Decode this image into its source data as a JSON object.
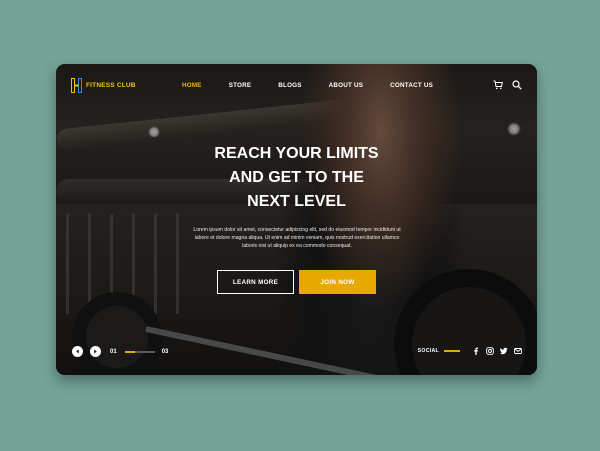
{
  "brand": {
    "name": "FITNESS CLUB",
    "accent": "#f2c400"
  },
  "nav": {
    "items": [
      {
        "label": "HOME",
        "active": true
      },
      {
        "label": "STORE",
        "active": false
      },
      {
        "label": "BLOGS",
        "active": false
      },
      {
        "label": "ABOUT US",
        "active": false
      },
      {
        "label": "CONTACT US",
        "active": false
      }
    ],
    "icons": [
      "cart-icon",
      "search-icon"
    ]
  },
  "hero": {
    "headline": [
      "REACH YOUR LIMITS",
      "AND GET TO THE",
      "NEXT LEVEL"
    ],
    "paragraph": "Lorem ipsum dolor sit amet, consectetur adipiscing elit, sed do eiusmod tempor incididunt ut labore et dolore magna aliqua. Ut enim ad minim veniam, quis nostrud exercitation ullamco laboris nisi ut aliquip ex ea commodo consequat.",
    "learn_label": "LEARN MORE",
    "join_label": "JOIN NOW",
    "join_color": "#e7a900"
  },
  "slider": {
    "current": "01",
    "total": "03",
    "progress": 0.33
  },
  "social": {
    "label": "SOCIAL",
    "icons": [
      "facebook-icon",
      "instagram-icon",
      "twitter-icon",
      "mail-icon"
    ]
  }
}
